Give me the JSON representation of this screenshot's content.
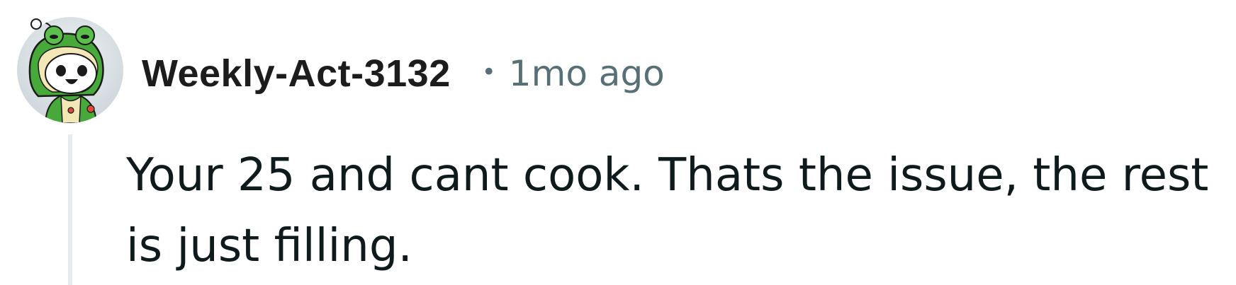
{
  "comment": {
    "author": "Weekly-Act-3132",
    "separator": "•",
    "timestamp": "1mo ago",
    "body": "Your 25 and cant cook. Thats the issue, the rest is just filling."
  },
  "avatar": {
    "icon": "snoo-frog-hood-avatar-icon",
    "colors": {
      "background": "#d9dfe3",
      "hood": "#47a93a",
      "face": "#ffffff",
      "outline": "#1a1a1a"
    }
  },
  "colors": {
    "username": "#1c1c1c",
    "meta": "#576f76",
    "body_text": "#0f1a1c",
    "thread_line": "#e5ebee"
  }
}
